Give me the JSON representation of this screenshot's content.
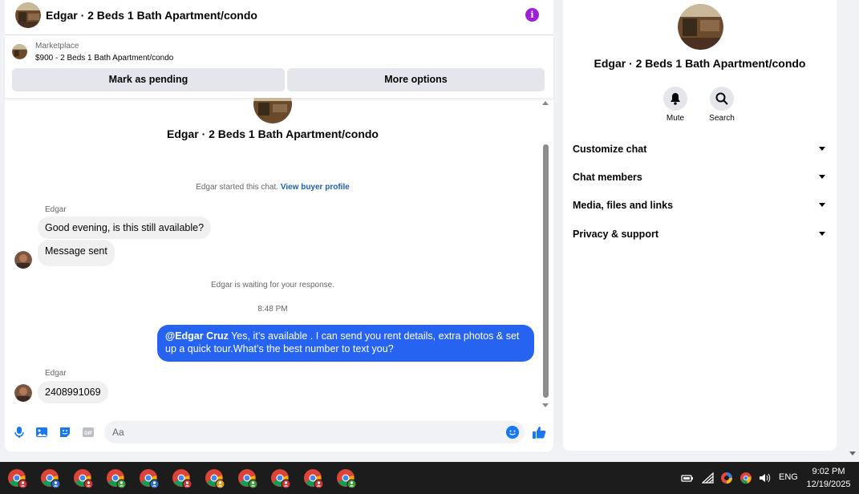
{
  "header": {
    "title": "Edgar · 2 Beds 1 Bath Apartment/condo"
  },
  "marketplace": {
    "label": "Marketplace",
    "listing": "$900 - 2 Beds 1 Bath Apartment/condo",
    "btn_pending": "Mark as pending",
    "btn_more": "More options"
  },
  "conversation": {
    "title": "Edgar · 2 Beds 1 Bath Apartment/condo",
    "started_text": "Edgar started this chat.",
    "view_profile": "View buyer profile",
    "sender1": "Edgar",
    "msg1": "Good evening, is this still available?",
    "msg2": "Message sent",
    "waiting": "Edgar is waiting for your response.",
    "time": "8:48 PM",
    "out_mention": "@Edgar Cruz",
    "out_text": " Yes, it’s available .  I can send you rent details, extra photos & set up a quick tour.What’s the best number to text you?",
    "sender2": "Edgar",
    "msg3": "2408991069"
  },
  "composer": {
    "placeholder": "Aa"
  },
  "info_panel": {
    "title": "Edgar · 2 Beds 1 Bath Apartment/condo",
    "mute": "Mute",
    "search": "Search",
    "sections": [
      "Customize chat",
      "Chat members",
      "Media, files and links",
      "Privacy & support"
    ]
  },
  "taskbar": {
    "lang": "ENG",
    "time": "9:02 PM",
    "date": "12/19/2025",
    "app_badge_colors": [
      "#c33",
      "#2a6bd1",
      "#c33",
      "#3a9a3a",
      "#2a6bd1",
      "#c33",
      "#d99a1a",
      "#3a9a3a",
      "#c33",
      "#c33",
      "#3a9a3a"
    ]
  },
  "colors": {
    "accent": "#1877f2",
    "outgoing_bubble": "#2563f0",
    "info_icon": "#a020d4"
  }
}
